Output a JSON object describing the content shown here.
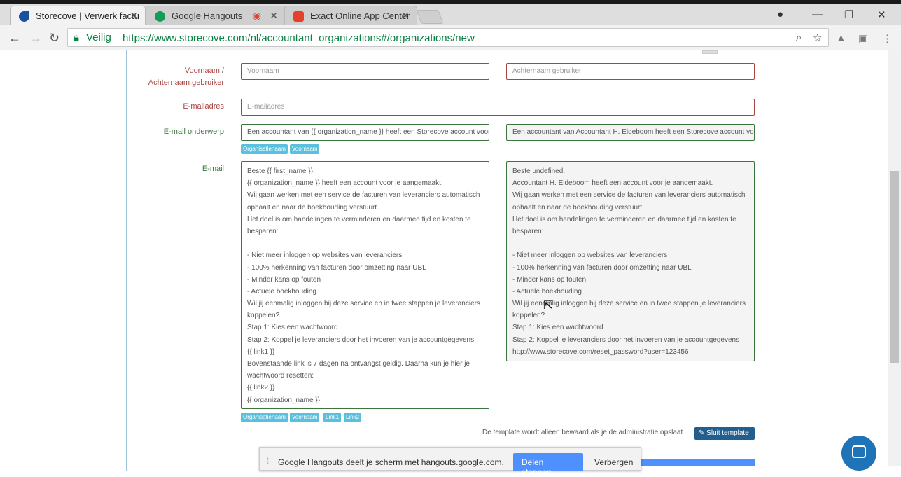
{
  "browser": {
    "tabs": [
      {
        "title": "Storecove | Verwerk factu",
        "color": "#1b4fa0"
      },
      {
        "title": "Google Hangouts",
        "color": "#0f9d58"
      },
      {
        "title": "Exact Online App Center",
        "color": "#e4412d"
      }
    ],
    "secure_label": "Veilig",
    "url": "https://www.storecove.com/nl/accountant_organizations#/organizations/new"
  },
  "form": {
    "name_label_part1": "Voornaam",
    "name_label_sep": " /",
    "name_label_part2": "Achternaam gebruiker",
    "first_name_placeholder": "Voornaam",
    "last_name_placeholder": "Achternaam gebruiker",
    "email_label": "E-mailadres",
    "email_placeholder": "E-mailadres",
    "subject_label": "E-mail onderwerp",
    "subject_template": "Een accountant van {{ organization_name }} heeft een Storecove account voor je aangemaakt",
    "subject_preview": "Een accountant van Accountant H. Eideboom heeft een Storecove account voor je aangemaakt",
    "subject_tags": [
      "Organisatienaam",
      "Voornaam"
    ],
    "body_label": "E-mail",
    "body_template": [
      "Beste {{ first_name }},",
      "{{ organization_name }} heeft een account voor je aangemaakt.",
      "Wij gaan werken met een service de facturen van leveranciers automatisch",
      "ophaalt en naar de boekhouding verstuurt.",
      "Het doel is om handelingen te verminderen en daarmee tijd en kosten te",
      "besparen:",
      "",
      "- Niet meer inloggen op websites van leveranciers",
      "- 100% herkenning van facturen door omzetting naar UBL",
      "- Minder kans op fouten",
      "- Actuele boekhouding",
      "Wil jij eenmalig inloggen bij deze service en in twee stappen je leveranciers",
      "koppelen?",
      "Stap 1: Kies een wachtwoord",
      "Stap 2: Koppel je leveranciers door het invoeren van je accountgegevens",
      "{{ link1 }}",
      "Bovenstaande link is 7 dagen na ontvangst geldig. Daarna kun je hier je",
      "wachtwoord resetten:",
      "{{ link2 }}",
      "{{ organization_name }}"
    ],
    "body_preview": [
      "Beste undefined,",
      "Accountant H. Eideboom heeft een account voor je aangemaakt.",
      "Wij gaan werken met een service de facturen van leveranciers automatisch",
      "ophaalt en naar de boekhouding verstuurt.",
      "Het doel is om handelingen te verminderen en daarmee tijd en kosten te",
      "besparen:",
      "",
      "- Niet meer inloggen op websites van leveranciers",
      "- 100% herkenning van facturen door omzetting naar UBL",
      "- Minder kans op fouten",
      "- Actuele boekhouding",
      "Wil jij eenmalig inloggen bij deze service en in twee stappen je leveranciers",
      "koppelen?",
      "Stap 1: Kies een wachtwoord",
      "Stap 2: Koppel je leveranciers door het invoeren van je accountgegevens",
      "http://www.storecove.com/reset_password?user=123456"
    ],
    "body_tags": [
      "Organisatienaam",
      "Voornaam",
      "Link1",
      "Link2"
    ],
    "template_note": "De template wordt alleen bewaard als je de administratie opslaat",
    "close_template_label": "Sluit template"
  },
  "hangouts_bar": {
    "message": "Google Hangouts deelt je scherm met hangouts.google.com.",
    "stop_label": "Delen stoppen",
    "hide_label": "Verbergen"
  }
}
